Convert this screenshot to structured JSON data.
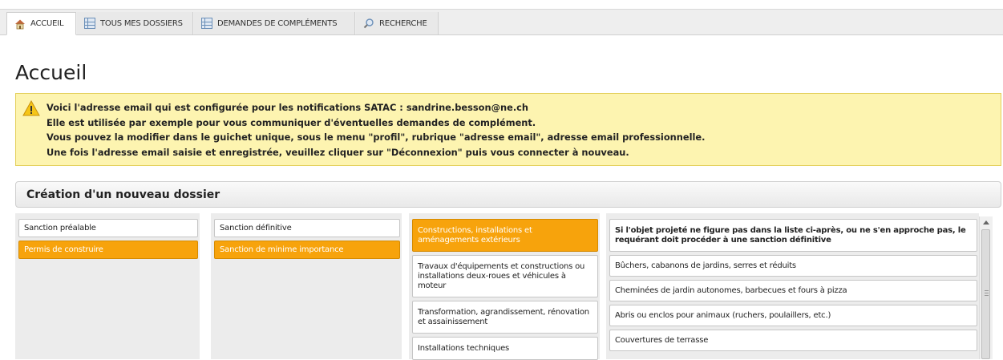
{
  "tabs": [
    {
      "label": "ACCUEIL",
      "icon": "home-icon",
      "active": true
    },
    {
      "label": "TOUS MES DOSSIERS",
      "icon": "grid-icon",
      "active": false
    },
    {
      "label": "DEMANDES DE COMPLÉMENTS",
      "icon": "grid-icon",
      "active": false
    },
    {
      "label": "RECHERCHE",
      "icon": "search-icon",
      "active": false
    }
  ],
  "page": {
    "title": "Accueil"
  },
  "notice": {
    "lines": [
      "Voici l'adresse email qui est configurée pour les notifications SATAC : sandrine.besson@ne.ch",
      "Elle est utilisée par exemple pour vous communiquer d'éventuelles demandes de complément.",
      "Vous pouvez la modifier dans le guichet unique, sous le menu \"profil\", rubrique \"adresse email\", adresse email professionnelle.",
      "Une fois l'adresse email saisie et enregistrée, veuillez cliquer sur \"Déconnexion\" puis vous connecter à nouveau."
    ]
  },
  "creation": {
    "title": "Création d'un nouveau dossier",
    "col1": [
      {
        "label": "Sanction préalable",
        "selected": false
      },
      {
        "label": "Permis de construire",
        "selected": true
      }
    ],
    "col2": [
      {
        "label": "Sanction définitive",
        "selected": false
      },
      {
        "label": "Sanction de minime importance",
        "selected": true
      }
    ],
    "col3": [
      {
        "label": "Constructions, installations et aménagements extérieurs",
        "selected": true
      },
      {
        "label": "Travaux d'équipements et constructions ou installations deux-roues et véhicules à moteur",
        "selected": false
      },
      {
        "label": "Transformation, agrandissement, rénovation et assainissement",
        "selected": false
      },
      {
        "label": "Installations techniques",
        "selected": false
      }
    ],
    "col4": [
      {
        "label": "Si l'objet projeté ne figure pas dans la liste ci-après, ou ne s'en approche pas, le requérant doit procéder à une sanction définitive",
        "bold": true
      },
      {
        "label": "Bûchers, cabanons de jardins, serres et réduits",
        "bold": false
      },
      {
        "label": "Cheminées de jardin autonomes, barbecues et fours à pizza",
        "bold": false
      },
      {
        "label": "Abris ou enclos pour animaux (ruchers, poulaillers, etc.)",
        "bold": false
      },
      {
        "label": "Couvertures de terrasse",
        "bold": false
      }
    ]
  },
  "colors": {
    "accent": "#f7a30c",
    "notice_bg": "#fdf4b0",
    "notice_border": "#e3cf5a"
  }
}
